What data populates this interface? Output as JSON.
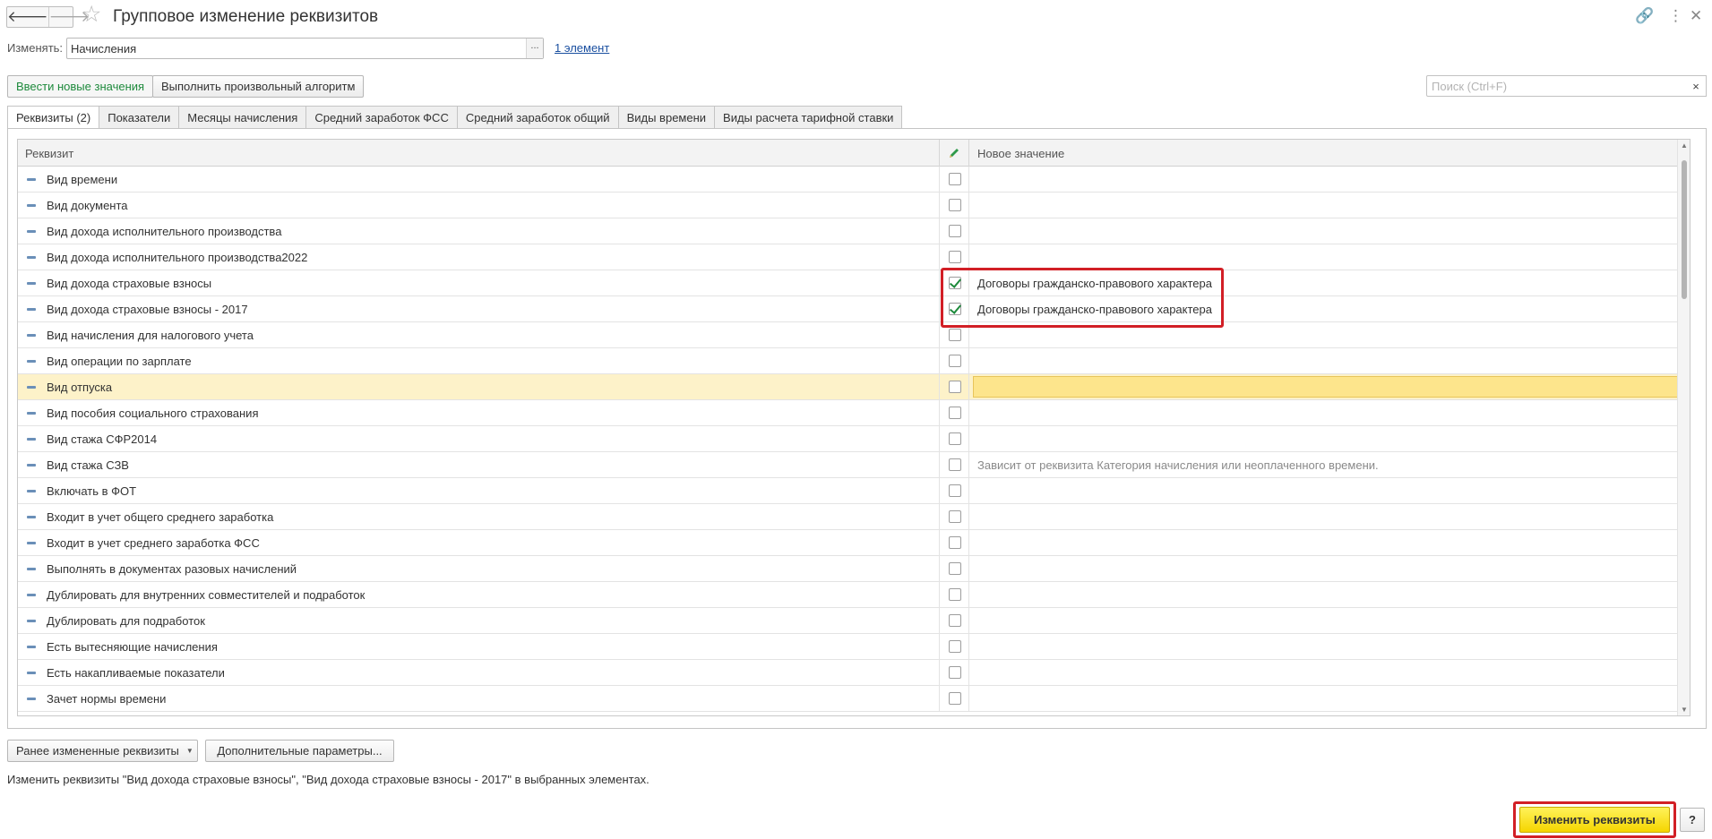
{
  "window": {
    "title": "Групповое изменение реквизитов",
    "back_icon": "🡐",
    "forward_icon": "🡒",
    "star_icon": "☆",
    "link_icon": "🔗",
    "more_icon": "⋮",
    "close_icon": "✕"
  },
  "change": {
    "label": "Изменять:",
    "value": "Начисления",
    "choose_button": "...",
    "selected_link": "1 элемент"
  },
  "toolbar": {
    "new_values": "Ввести новые значения",
    "run_algorithm": "Выполнить произвольный алгоритм",
    "search_placeholder": "Поиск (Ctrl+F)",
    "search_clear": "×"
  },
  "tabs": [
    {
      "label": "Реквизиты (2)",
      "active": true
    },
    {
      "label": "Показатели"
    },
    {
      "label": "Месяцы начисления"
    },
    {
      "label": "Средний заработок ФСС"
    },
    {
      "label": "Средний заработок общий"
    },
    {
      "label": "Виды времени"
    },
    {
      "label": "Виды расчета тарифной ставки"
    }
  ],
  "grid": {
    "columns": {
      "attribute": "Реквизит",
      "edit_icon": "✏",
      "new_value": "Новое значение"
    },
    "rows": [
      {
        "name": "Вид времени",
        "checked": false,
        "value": ""
      },
      {
        "name": "Вид документа",
        "checked": false,
        "value": ""
      },
      {
        "name": "Вид дохода исполнительного производства",
        "checked": false,
        "value": ""
      },
      {
        "name": "Вид дохода исполнительного производства2022",
        "checked": false,
        "value": ""
      },
      {
        "name": "Вид дохода страховые взносы",
        "checked": true,
        "value": "Договоры гражданско-правового характера"
      },
      {
        "name": "Вид дохода страховые взносы - 2017",
        "checked": true,
        "value": "Договоры гражданско-правового характера"
      },
      {
        "name": "Вид начисления для налогового учета",
        "checked": false,
        "value": ""
      },
      {
        "name": "Вид операции по зарплате",
        "checked": false,
        "value": ""
      },
      {
        "name": "Вид отпуска",
        "checked": false,
        "value": "",
        "selected": true
      },
      {
        "name": "Вид пособия социального страхования",
        "checked": false,
        "value": ""
      },
      {
        "name": "Вид стажа  СФР2014",
        "checked": false,
        "value": ""
      },
      {
        "name": "Вид стажа СЗВ",
        "checked": false,
        "value": "Зависит от реквизита Категория начисления или неоплаченного времени.",
        "hint": true
      },
      {
        "name": "Включать в ФОТ",
        "checked": false,
        "value": ""
      },
      {
        "name": "Входит в учет общего среднего заработка",
        "checked": false,
        "value": ""
      },
      {
        "name": "Входит в учет среднего заработка ФСС",
        "checked": false,
        "value": ""
      },
      {
        "name": "Выполнять в документах разовых начислений",
        "checked": false,
        "value": ""
      },
      {
        "name": "Дублировать для внутренних совместителей и подработок",
        "checked": false,
        "value": ""
      },
      {
        "name": "Дублировать для подработок",
        "checked": false,
        "value": ""
      },
      {
        "name": "Есть вытесняющие начисления",
        "checked": false,
        "value": ""
      },
      {
        "name": "Есть накапливаемые показатели",
        "checked": false,
        "value": ""
      },
      {
        "name": "Зачет нормы времени",
        "checked": false,
        "value": ""
      }
    ]
  },
  "bottom": {
    "previous_button": "Ранее измененные реквизиты",
    "extra_params_button": "Дополнительные параметры...",
    "caption": "Изменить реквизиты \"Вид дохода страховые взносы\", \"Вид дохода страховые взносы - 2017\" в выбранных элементах.",
    "apply_button": "Изменить реквизиты",
    "help_button": "?"
  },
  "colors": {
    "accent_green": "#1e8a3c",
    "highlight_row": "#fdf2c9",
    "editor_yellow": "#fde58c",
    "primary_button": "#f5d500",
    "callout_red": "#d21f26"
  }
}
